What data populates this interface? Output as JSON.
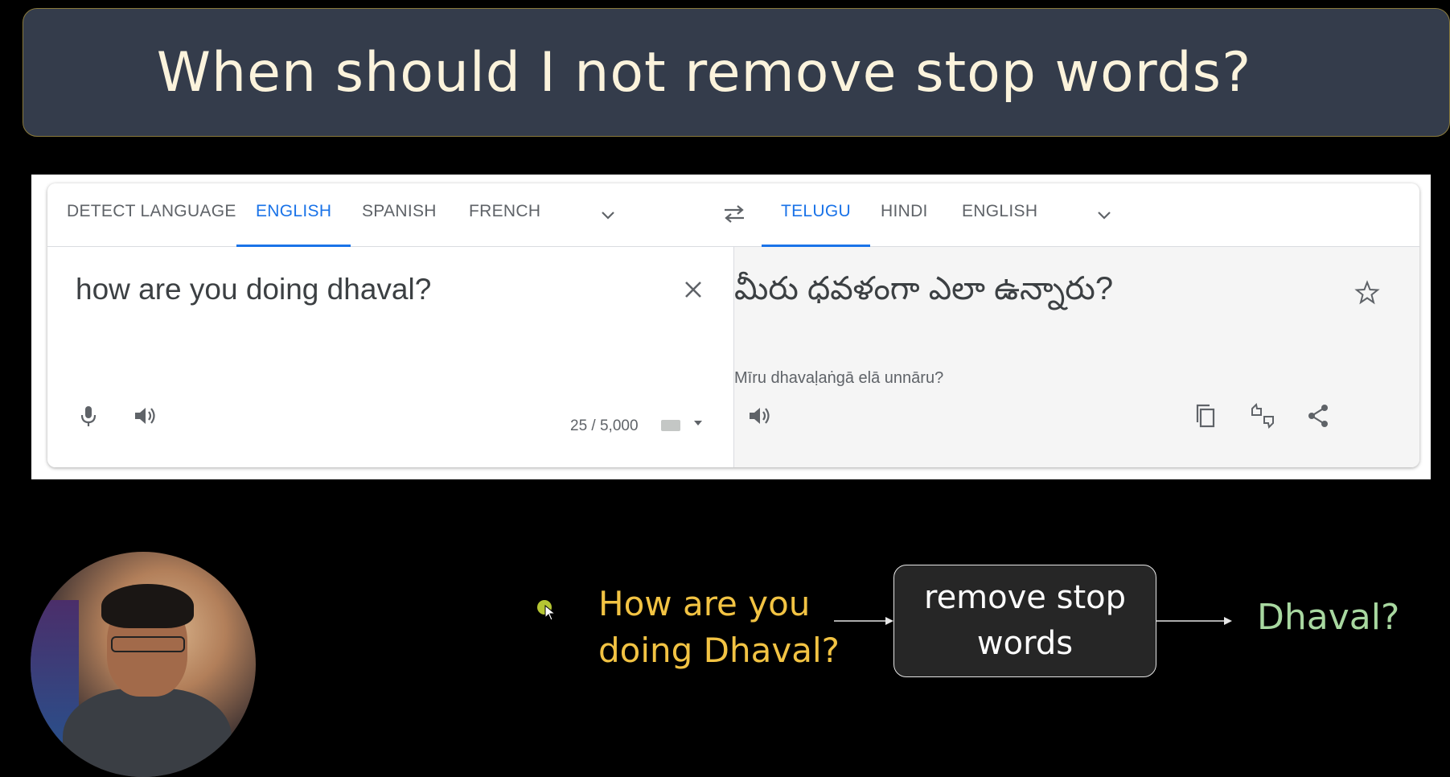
{
  "slide": {
    "title": "When should I not remove stop words?"
  },
  "translator": {
    "source_tabs": [
      {
        "label": "DETECT LANGUAGE",
        "active": false
      },
      {
        "label": "ENGLISH",
        "active": true
      },
      {
        "label": "SPANISH",
        "active": false
      },
      {
        "label": "FRENCH",
        "active": false
      }
    ],
    "target_tabs": [
      {
        "label": "TELUGU",
        "active": true
      },
      {
        "label": "HINDI",
        "active": false
      },
      {
        "label": "ENGLISH",
        "active": false
      }
    ],
    "source_text": "how are you doing dhaval?",
    "char_count": "25 / 5,000",
    "target_text": "మీరు ధవళంగా ఎలా ఉన్నారు?",
    "transliteration": "Mīru dhavaḷaṅgā elā unnāru?",
    "accent_color": "#1a73e8",
    "icons": [
      "chevron-down-icon",
      "swap-languages-icon",
      "close-icon",
      "microphone-icon",
      "speaker-icon",
      "keyboard-icon",
      "star-icon",
      "copy-icon",
      "feedback-icon",
      "share-icon"
    ]
  },
  "flow": {
    "input_line1": "How are you",
    "input_line2": "doing Dhaval?",
    "process_line1": "remove stop",
    "process_line2": "words",
    "output": "Dhaval?",
    "colors": {
      "input": "#f2c343",
      "output": "#a8d8a0",
      "box": "#262626"
    }
  }
}
